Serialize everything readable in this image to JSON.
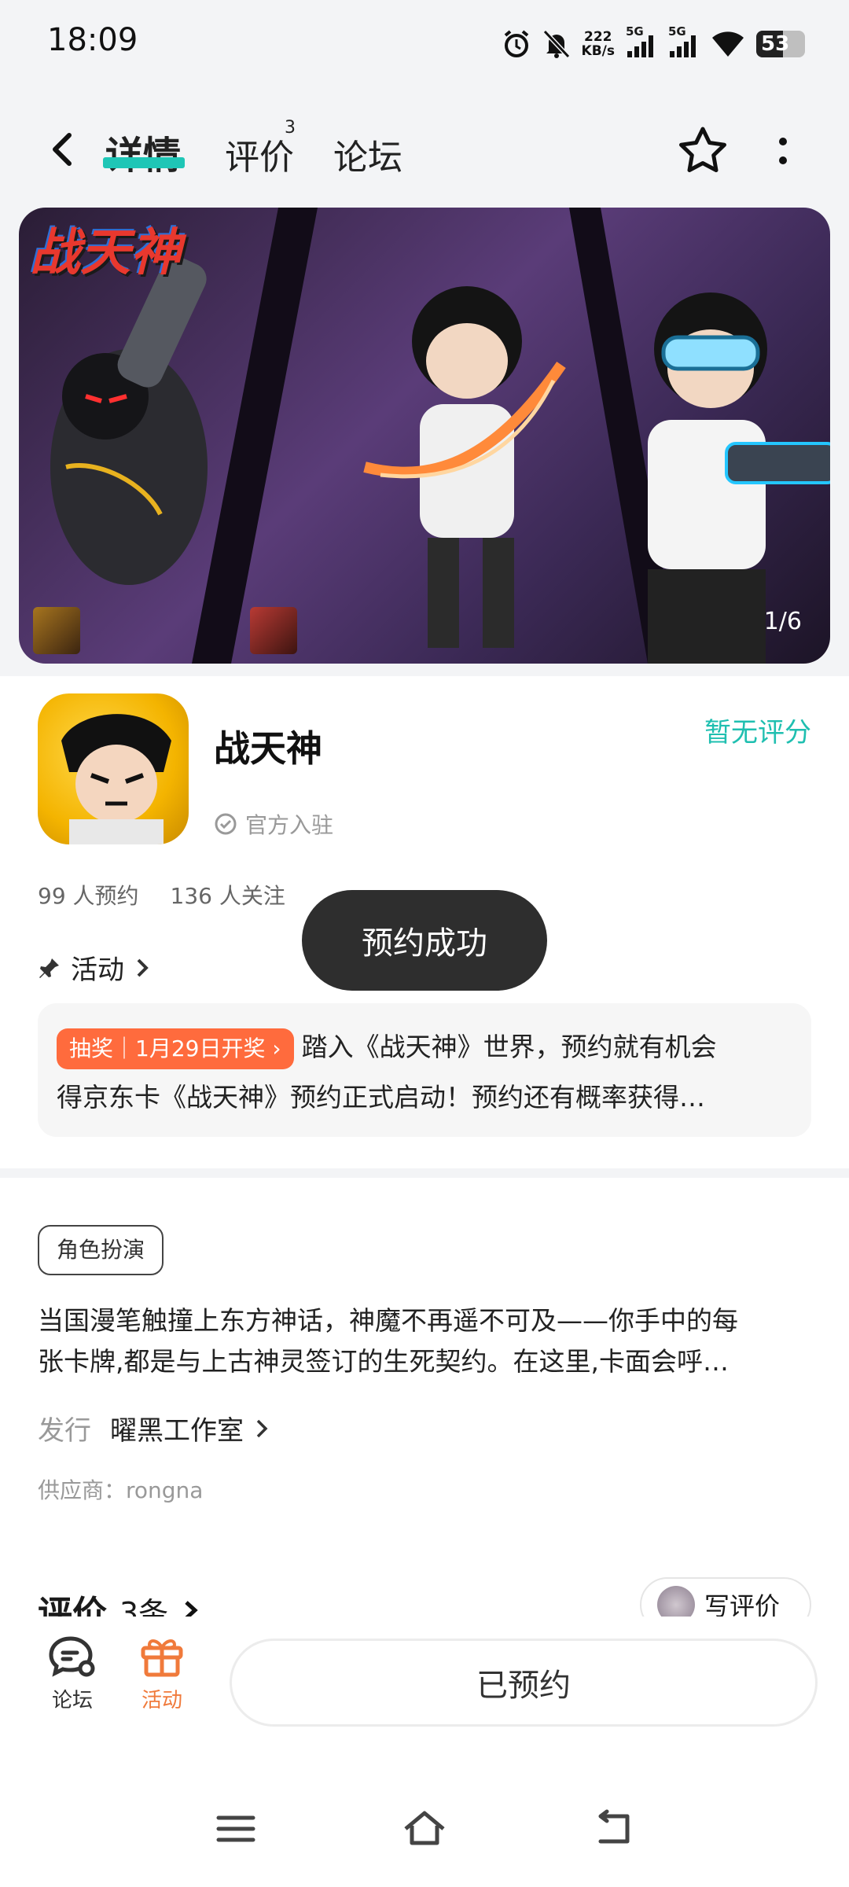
{
  "status_bar": {
    "time": "18:09",
    "speed_value": "222",
    "speed_unit": "KB/s",
    "signal_1": "5G",
    "signal_2": "5G",
    "battery": "53"
  },
  "nav": {
    "tabs": [
      {
        "label": "详情",
        "active": true
      },
      {
        "label": "评价",
        "badge": "3"
      },
      {
        "label": "论坛"
      }
    ]
  },
  "banner": {
    "logo_text": "战天神",
    "counter": "1/6"
  },
  "app": {
    "name": "战天神",
    "official_label": "官方入驻",
    "rating": "暂无评分",
    "reservations": "99 人预约",
    "followers": "136 人关注",
    "activity_label": "活动"
  },
  "toast": "预约成功",
  "promo": {
    "tag": "抽奖｜1月29日开奖",
    "line1": "踏入《战天神》世界，预约就有机会",
    "line2": "得京东卡《战天神》预约正式启动！预约还有概率获得…"
  },
  "details": {
    "genre": "角色扮演",
    "desc_line1": "当国漫笔触撞上东方神话，神魔不再遥不可及——你手中的每",
    "desc_line2": "张卡牌,都是与上古神灵签订的生死契约。在这里,卡面会呼…",
    "publisher_label": "发行",
    "publisher_name": "曜黑工作室",
    "supplier": "供应商：rongna"
  },
  "reviews": {
    "title": "评价",
    "count": "3条",
    "write_label": "写评价"
  },
  "bottom_bar": {
    "forum_label": "论坛",
    "activity_label": "活动",
    "reserved_label": "已预约"
  },
  "colors": {
    "accent": "#1fc6b6",
    "promo_tag": "#ff6b3d",
    "activity_orange": "#f07a3b"
  }
}
